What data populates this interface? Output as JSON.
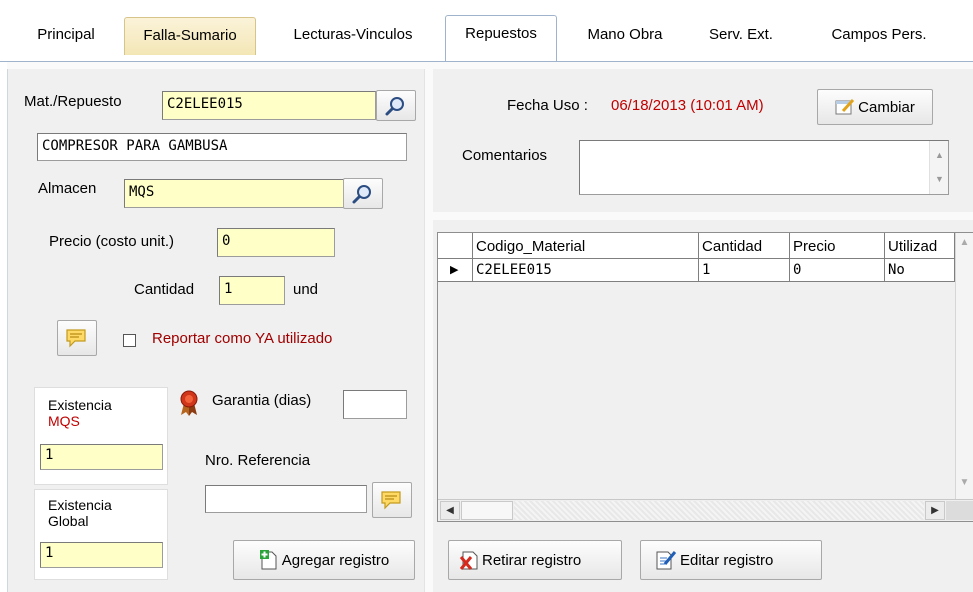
{
  "tabs": [
    {
      "label": "Principal"
    },
    {
      "label": "Falla-Sumario"
    },
    {
      "label": "Lecturas-Vinculos"
    },
    {
      "label": "Repuestos"
    },
    {
      "label": "Mano Obra"
    },
    {
      "label": "Serv. Ext."
    },
    {
      "label": "Campos Pers."
    }
  ],
  "form": {
    "material_label": "Mat./Repuesto",
    "material_value": "C2ELEE015",
    "description_value": "COMPRESOR  PARA GAMBUSA",
    "almacen_label": "Almacen",
    "almacen_value": "MQS",
    "precio_label": "Precio (costo unit.)",
    "precio_value": "0",
    "cantidad_label": "Cantidad",
    "cantidad_value": "1",
    "unidad_label": "und",
    "reportar_label": "Reportar como YA utilizado",
    "reportar_checked": false,
    "existencia_label": "Existencia",
    "existencia_almacen": "MQS",
    "existencia_value": "1",
    "existencia_global_label_1": "Existencia",
    "existencia_global_label_2": "Global",
    "existencia_global_value": "1",
    "garantia_label": "Garantia (dias)",
    "garantia_value": "",
    "referencia_label": "Nro. Referencia",
    "referencia_value": "",
    "agregar_label": "Agregar registro"
  },
  "usage": {
    "fecha_label": "Fecha Uso :",
    "fecha_value": "06/18/2013 (10:01 AM)",
    "cambiar_label": "Cambiar",
    "comentarios_label": "Comentarios",
    "comentarios_value": ""
  },
  "grid": {
    "columns": [
      "Codigo_Material",
      "Cantidad",
      "Precio",
      "Utilizad"
    ],
    "rows": [
      {
        "codigo": "C2ELEE015",
        "cantidad": "1",
        "precio": "0",
        "utilizado": "No"
      }
    ]
  },
  "actions": {
    "retirar_label": "Retirar registro",
    "editar_label": "Editar registro"
  },
  "colors": {
    "input_yellow": "#ffffc8",
    "accent_red": "#c00000",
    "tab_highlight": "#f3e6b6"
  }
}
